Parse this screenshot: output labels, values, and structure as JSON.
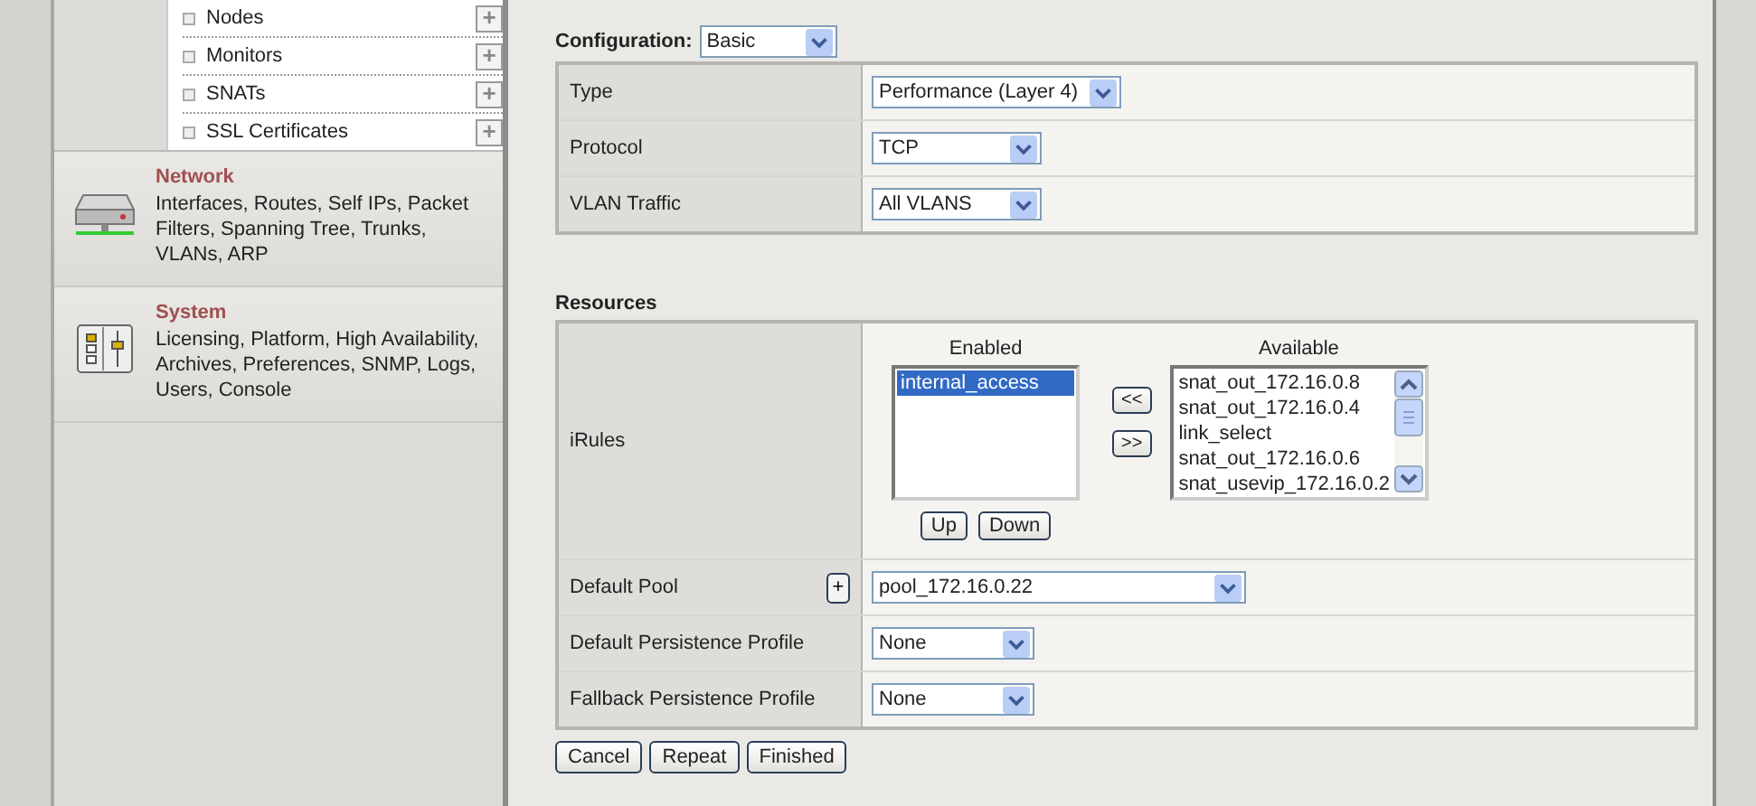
{
  "sidebar": {
    "sub_items": [
      {
        "label": "Nodes",
        "add_button": "+"
      },
      {
        "label": "Monitors",
        "add_button": "+"
      },
      {
        "label": "SNATs",
        "add_button": "+"
      },
      {
        "label": "SSL Certificates",
        "add_button": "+"
      }
    ],
    "sections": [
      {
        "kind": "network",
        "title": "Network",
        "description": "Interfaces, Routes, Self IPs, Packet Filters, Spanning Tree, Trunks, VLANs, ARP"
      },
      {
        "kind": "system",
        "title": "System",
        "description": "Licensing, Platform, High Availability, Archives, Preferences, SNMP, Logs, Users, Console"
      }
    ]
  },
  "configuration": {
    "label": "Configuration:",
    "value": "Basic"
  },
  "general_rows": [
    {
      "label": "Type",
      "value": "Performance (Layer 4)"
    },
    {
      "label": "Protocol",
      "value": "TCP"
    },
    {
      "label": "VLAN Traffic",
      "value": "All VLANS"
    }
  ],
  "resources": {
    "title": "Resources",
    "irules": {
      "label": "iRules",
      "enabled_heading": "Enabled",
      "available_heading": "Available",
      "enabled": [
        {
          "label": "internal_access",
          "selected": true
        }
      ],
      "available": [
        {
          "label": "snat_out_172.16.0.8",
          "selected": false
        },
        {
          "label": "snat_out_172.16.0.4",
          "selected": false
        },
        {
          "label": "link_select",
          "selected": false
        },
        {
          "label": "snat_out_172.16.0.6",
          "selected": false
        },
        {
          "label": "snat_usevip_172.16.0.2",
          "selected": false
        }
      ],
      "move_left": "<<",
      "move_right": ">>",
      "up": "Up",
      "down": "Down"
    },
    "rows": [
      {
        "label": "Default Pool",
        "value": "pool_172.16.0.22",
        "add_button": "+"
      },
      {
        "label": "Default Persistence Profile",
        "value": "None"
      },
      {
        "label": "Fallback Persistence Profile",
        "value": "None"
      }
    ]
  },
  "buttons": [
    "Cancel",
    "Repeat",
    "Finished"
  ]
}
